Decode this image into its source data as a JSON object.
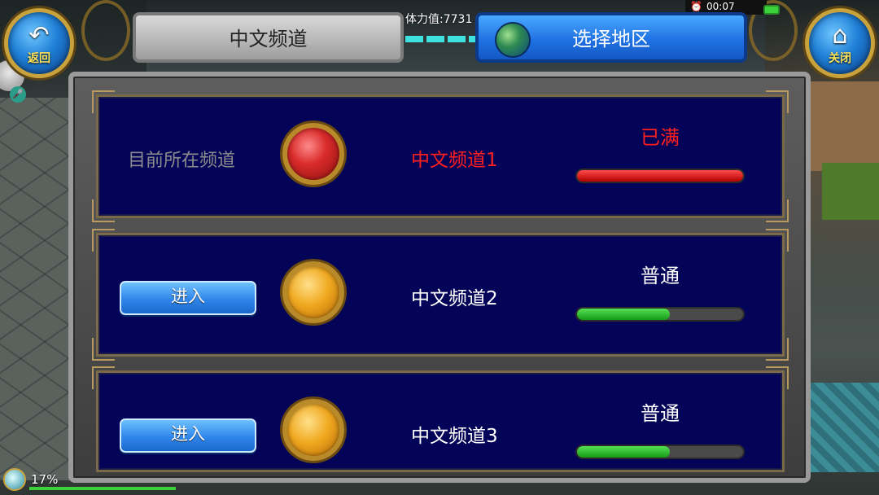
{
  "header": {
    "back_button": {
      "icon": "back-arrow-icon",
      "label": "返回"
    },
    "close_button": {
      "icon": "home-icon",
      "label": "关闭"
    },
    "stamina_text": "体力值:7731",
    "tabs": [
      {
        "label": "中文频道",
        "active": false
      },
      {
        "label": "选择地区",
        "active": true,
        "icon": "globe-icon"
      }
    ]
  },
  "status_bar": {
    "time": "00:07",
    "alarm_icon": "alarm-icon",
    "battery_icon": "battery-icon"
  },
  "channels": [
    {
      "current_label": "目前所在频道",
      "name": "中文频道1",
      "status": "已满",
      "status_color": "#ff1f1f",
      "load": 1.0,
      "orb_color": "red",
      "is_current": true
    },
    {
      "enter_label": "进入",
      "name": "中文频道2",
      "status": "普通",
      "status_color": "#ffffff",
      "load": 0.56,
      "orb_color": "gold",
      "is_current": false
    },
    {
      "enter_label": "进入",
      "name": "中文频道3",
      "status": "普通",
      "status_color": "#ffffff",
      "load": 0.56,
      "orb_color": "gold",
      "is_current": false
    }
  ],
  "bottom_hud": {
    "percent": "17%"
  }
}
